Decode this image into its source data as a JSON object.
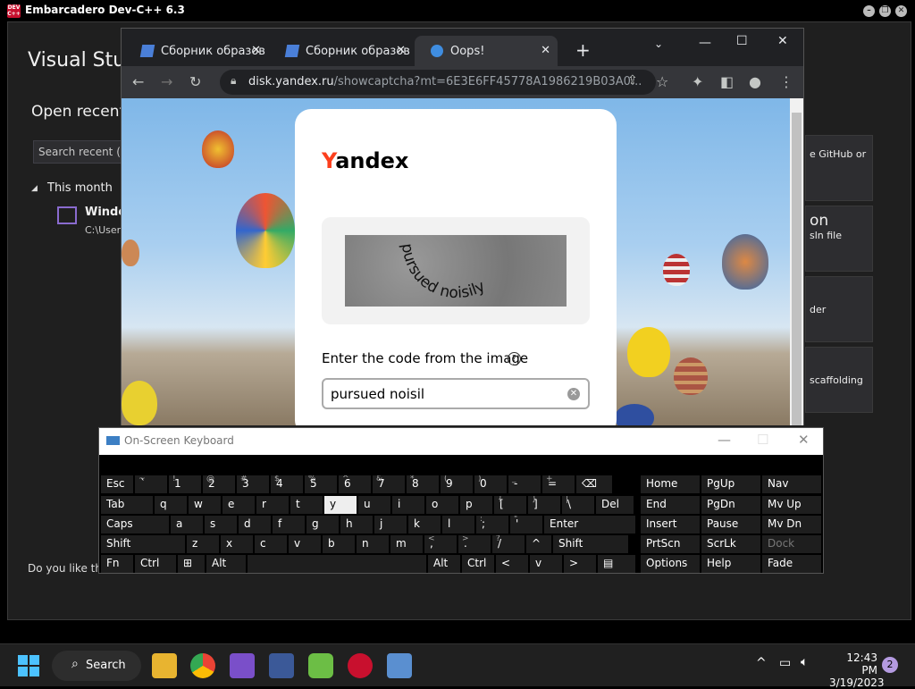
{
  "devcpp": {
    "title": "Embarcadero Dev-C++ 6.3",
    "icon_text": "DEV C++"
  },
  "vs": {
    "title": "Visual Stu",
    "open_recent": "Open recent",
    "search_placeholder": "Search recent (Alt",
    "group": "This month",
    "solution_name": "Windo",
    "solution_path": "C:\\Users",
    "feedback": "Do you like this",
    "cards": [
      {
        "line1": "",
        "line2": "e GitHub or"
      },
      {
        "line1": "on",
        "line2": "sln file"
      },
      {
        "line1": "",
        "line2": "der"
      },
      {
        "line1": "",
        "line2": "scaffolding"
      }
    ]
  },
  "chrome": {
    "tabs": [
      {
        "label": "Сборник образов",
        "close": "✕"
      },
      {
        "label": "Сборник образов",
        "close": "✕"
      },
      {
        "label": "Oops!",
        "close": "✕"
      }
    ],
    "new_tab": "+",
    "url_host": "disk.yandex.ru",
    "url_path": "/showcaptcha?mt=6E3E6FF45778A1986219B03A0..."
  },
  "captcha": {
    "logo_y": "Y",
    "logo_rest": "andex",
    "captcha_text": "pursued noisily",
    "prompt": "Enter the code from the image",
    "help": "?",
    "input_value": "pursued noisil",
    "clear": "✕"
  },
  "osk": {
    "title": "On-Screen Keyboard",
    "rows": [
      [
        [
          "Esc",
          ""
        ],
        [
          "`",
          "~"
        ],
        [
          "1",
          "!"
        ],
        [
          "2",
          "@"
        ],
        [
          "3",
          "#"
        ],
        [
          "4",
          "$"
        ],
        [
          "5",
          "%"
        ],
        [
          "6",
          "^"
        ],
        [
          "7",
          "&"
        ],
        [
          "8",
          "*"
        ],
        [
          "9",
          "("
        ],
        [
          "0",
          ")"
        ],
        [
          "-",
          "_"
        ],
        [
          "=",
          "+"
        ],
        [
          "⌫",
          ""
        ]
      ],
      [
        [
          "Tab",
          ""
        ],
        [
          "q",
          ""
        ],
        [
          "w",
          ""
        ],
        [
          "e",
          ""
        ],
        [
          "r",
          ""
        ],
        [
          "t",
          ""
        ],
        [
          "y",
          ""
        ],
        [
          "u",
          ""
        ],
        [
          "i",
          ""
        ],
        [
          "o",
          ""
        ],
        [
          "p",
          ""
        ],
        [
          "[",
          "{"
        ],
        [
          "]",
          "}"
        ],
        [
          "\\",
          "|"
        ],
        [
          "Del",
          ""
        ]
      ],
      [
        [
          "Caps",
          ""
        ],
        [
          "a",
          ""
        ],
        [
          "s",
          ""
        ],
        [
          "d",
          ""
        ],
        [
          "f",
          ""
        ],
        [
          "g",
          ""
        ],
        [
          "h",
          ""
        ],
        [
          "j",
          ""
        ],
        [
          "k",
          ""
        ],
        [
          "l",
          ""
        ],
        [
          ";",
          ":"
        ],
        [
          "'",
          "\""
        ],
        [
          "Enter",
          ""
        ]
      ],
      [
        [
          "Shift",
          ""
        ],
        [
          "z",
          ""
        ],
        [
          "x",
          ""
        ],
        [
          "c",
          ""
        ],
        [
          "v",
          ""
        ],
        [
          "b",
          ""
        ],
        [
          "n",
          ""
        ],
        [
          "m",
          ""
        ],
        [
          ",",
          "<"
        ],
        [
          ".",
          ">"
        ],
        [
          "/",
          "?"
        ],
        [
          "^",
          ""
        ],
        [
          "Shift",
          ""
        ]
      ],
      [
        [
          "Fn",
          ""
        ],
        [
          "Ctrl",
          ""
        ],
        [
          "⊞",
          ""
        ],
        [
          "Alt",
          ""
        ],
        [
          "",
          ""
        ],
        [
          "Alt",
          ""
        ],
        [
          "Ctrl",
          ""
        ],
        [
          "<",
          ""
        ],
        [
          "v",
          ""
        ],
        [
          ">",
          ""
        ],
        [
          "▤",
          ""
        ]
      ]
    ],
    "nav": [
      [
        "Home",
        "PgUp",
        "Nav"
      ],
      [
        "End",
        "PgDn",
        "Mv Up"
      ],
      [
        "Insert",
        "Pause",
        "Mv Dn"
      ],
      [
        "PrtScn",
        "ScrLk",
        "Dock"
      ],
      [
        "Options",
        "Help",
        "Fade"
      ]
    ]
  },
  "taskbar": {
    "search": "Search",
    "time": "12:43 PM",
    "date": "3/19/2023",
    "notifications": "2"
  }
}
